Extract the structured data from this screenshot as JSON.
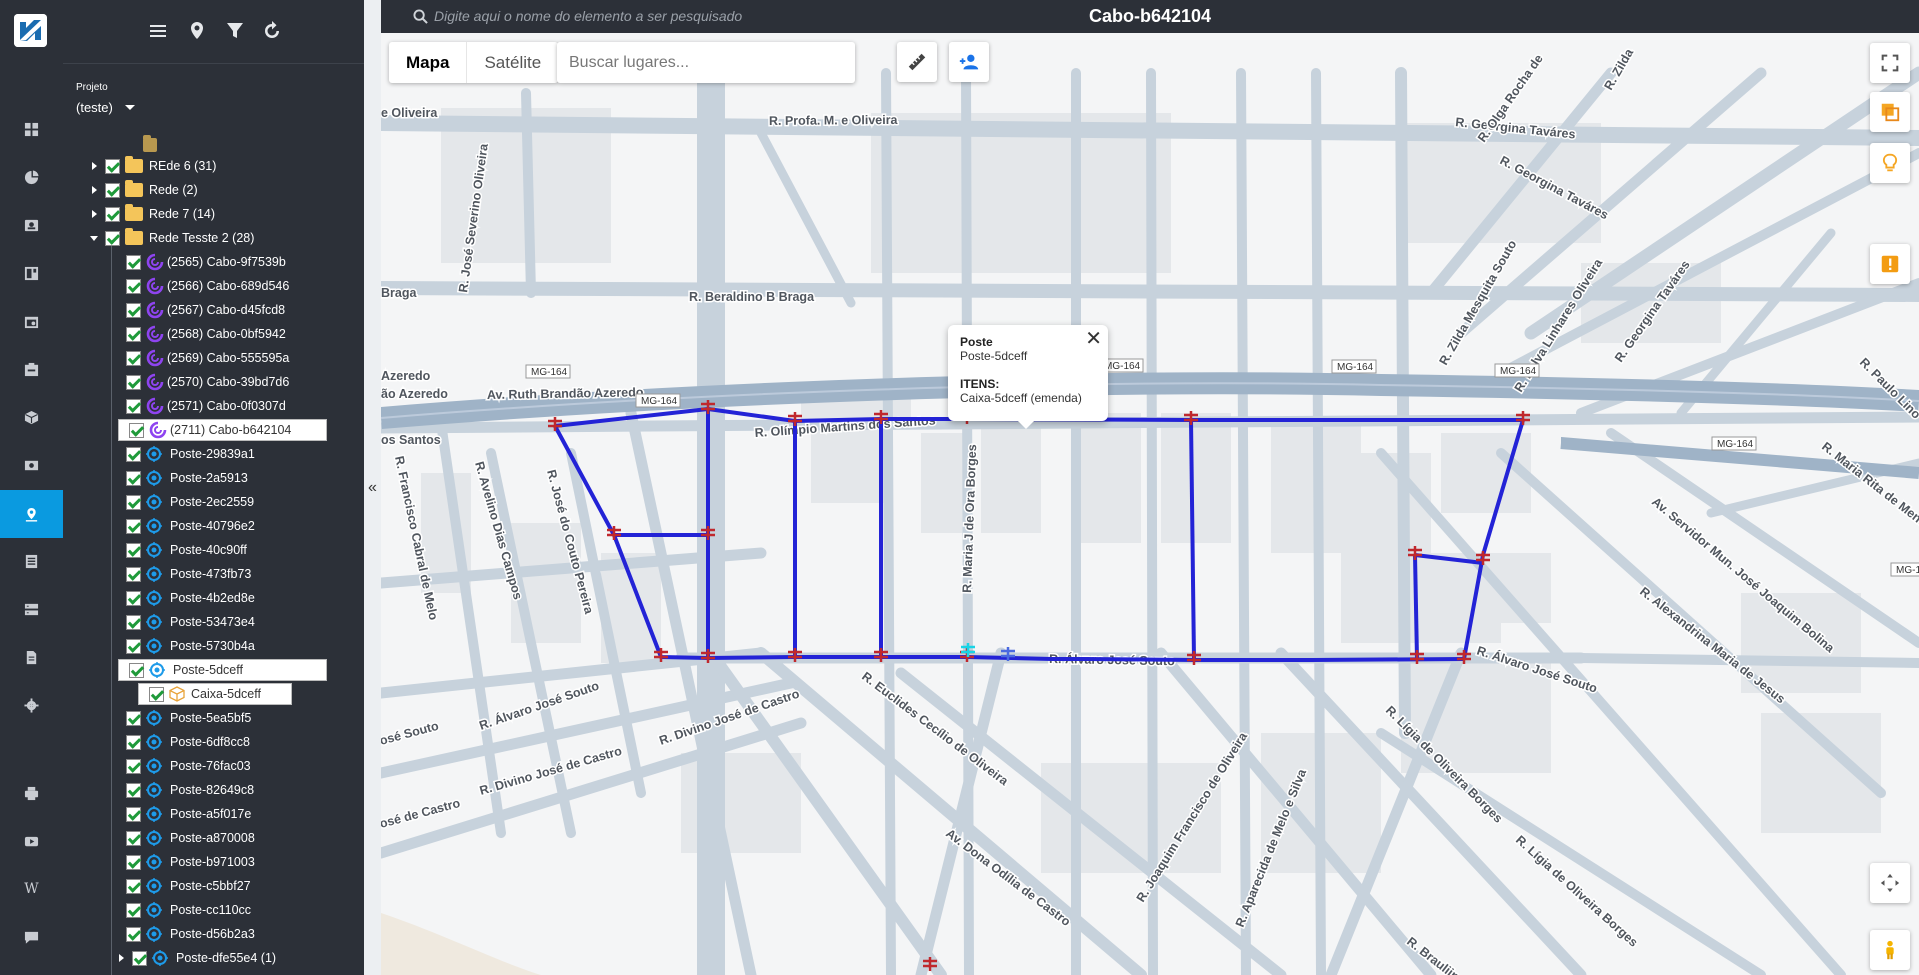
{
  "header": {
    "search_placeholder": "Digite aqui o nome do elemento a ser pesquisado",
    "title": "Cabo-b642104"
  },
  "rail": {
    "items": [
      "grid-icon",
      "pie-chart-icon",
      "contact-card-icon",
      "dashboard-icon",
      "calendar-icon",
      "tasks-icon",
      "box-icon",
      "money-icon",
      "map-pin-icon",
      "list-icon",
      "server-icon",
      "document-icon",
      "gear-icon",
      "printer-icon",
      "video-icon",
      "wikipedia-icon",
      "chat-icon"
    ],
    "active": "map-pin-icon"
  },
  "panel": {
    "toolbar": [
      "menu-icon",
      "location-icon",
      "filter-icon",
      "refresh-icon"
    ],
    "project_label": "Projeto",
    "project_value": "(teste)",
    "collapse_glyph": "«"
  },
  "tree": [
    {
      "label": "REde 6 (31)",
      "type": "folder",
      "level": 0,
      "expander": "right"
    },
    {
      "label": "Rede (2)",
      "type": "folder",
      "level": 0,
      "expander": "right"
    },
    {
      "label": "Rede 7 (14)",
      "type": "folder",
      "level": 0,
      "expander": "right"
    },
    {
      "label": "Rede Tesste 2 (28)",
      "type": "folder",
      "level": 0,
      "expander": "down"
    },
    {
      "label": "(2565) Cabo-9f7539b",
      "type": "cabo",
      "level": 1
    },
    {
      "label": "(2566) Cabo-689d546",
      "type": "cabo",
      "level": 1
    },
    {
      "label": "(2567) Cabo-d45fcd8",
      "type": "cabo",
      "level": 1
    },
    {
      "label": "(2568) Cabo-0bf5942",
      "type": "cabo",
      "level": 1
    },
    {
      "label": "(2569) Cabo-555595a",
      "type": "cabo",
      "level": 1
    },
    {
      "label": "(2570) Cabo-39bd7d6",
      "type": "cabo",
      "level": 1
    },
    {
      "label": "(2571) Cabo-0f0307d",
      "type": "cabo",
      "level": 1
    },
    {
      "label": "(2711) Cabo-b642104",
      "type": "cabo",
      "level": 1,
      "selected": true
    },
    {
      "label": "Poste-29839a1",
      "type": "poste",
      "level": 1
    },
    {
      "label": "Poste-2a5913",
      "type": "poste",
      "level": 1
    },
    {
      "label": "Poste-2ec2559",
      "type": "poste",
      "level": 1
    },
    {
      "label": "Poste-40796e2",
      "type": "poste",
      "level": 1
    },
    {
      "label": "Poste-40c90ff",
      "type": "poste",
      "level": 1
    },
    {
      "label": "Poste-473fb73",
      "type": "poste",
      "level": 1
    },
    {
      "label": "Poste-4b2ed8e",
      "type": "poste",
      "level": 1
    },
    {
      "label": "Poste-53473e4",
      "type": "poste",
      "level": 1
    },
    {
      "label": "Poste-5730b4a",
      "type": "poste",
      "level": 1
    },
    {
      "label": "Poste-5dceff",
      "type": "poste",
      "level": 1,
      "selected": true
    },
    {
      "label": "Caixa-5dceff",
      "type": "caixa",
      "level": 2,
      "selected": true
    },
    {
      "label": "Poste-5ea5bf5",
      "type": "poste",
      "level": 1
    },
    {
      "label": "Poste-6df8cc8",
      "type": "poste",
      "level": 1
    },
    {
      "label": "Poste-76fac03",
      "type": "poste",
      "level": 1
    },
    {
      "label": "Poste-82649c8",
      "type": "poste",
      "level": 1
    },
    {
      "label": "Poste-a5f017e",
      "type": "poste",
      "level": 1
    },
    {
      "label": "Poste-a870008",
      "type": "poste",
      "level": 1
    },
    {
      "label": "Poste-b971003",
      "type": "poste",
      "level": 1
    },
    {
      "label": "Poste-c5bbf27",
      "type": "poste",
      "level": 1
    },
    {
      "label": "Poste-cc110cc",
      "type": "poste",
      "level": 1
    },
    {
      "label": "Poste-d56b2a3",
      "type": "poste",
      "level": 1
    },
    {
      "label": "Poste-dfe55e4 (1)",
      "type": "poste",
      "level": 1,
      "expander": "right"
    }
  ],
  "map": {
    "map_type": {
      "mapa": "Mapa",
      "satelite": "Satélite"
    },
    "place_search_placeholder": "Buscar lugares...",
    "popup": {
      "title": "Poste",
      "name": "Poste-5dceff",
      "items_label": "ITENS:",
      "item": "Caixa-5dceff (emenda)",
      "close": "✕"
    },
    "streets": [
      "R. Profa. M. e Oliveira",
      "R. Georgina Taváres",
      "R. Beraldino B Braga",
      "Av. Ruth Brandão Azeredo",
      "R. Olímpio Martins dos Santos",
      "R. Álvaro José Souto",
      "R. Álvaro José Souto",
      "R. Álvaro José Souto",
      "R. Divino José de Castro",
      "R. Euclides Cecílio de Oliveira",
      "Av. Dona Odília de Castro",
      "R. Joaquim Francisco de Oliveira",
      "R. Lígia de Oliveira Borges",
      "R. Zilda Mesquita Souto",
      "R. Dalva Linhares Oliveira",
      "R. Maria J de Ora Borges",
      "R. Georgina Taváres",
      "R. José Severino Oliveira",
      "R. Francisco Cabral de Melo",
      "R. Avelino Dias Campos",
      "R. José do Couto Pereira",
      "Av. Servidor Mun. José Joaquim Bolina",
      "R. Alexandrina Maria de Jesus",
      "R. Maria Rita de Menezes",
      "R. Olga Rocha de",
      "R. Zilda",
      "R. Paulo Lino",
      "R. Brauliina",
      "R. Aparecida de Melo e Silva",
      "e Oliveira",
      "Braga",
      "Azeredo",
      "ão Azeredo",
      "os Santos",
      "osé Souto",
      "osé de Castro",
      "MG-164",
      "MG-164",
      "MG-164",
      "MG-164",
      "MG-164",
      "MG-164",
      "MG-164"
    ]
  }
}
